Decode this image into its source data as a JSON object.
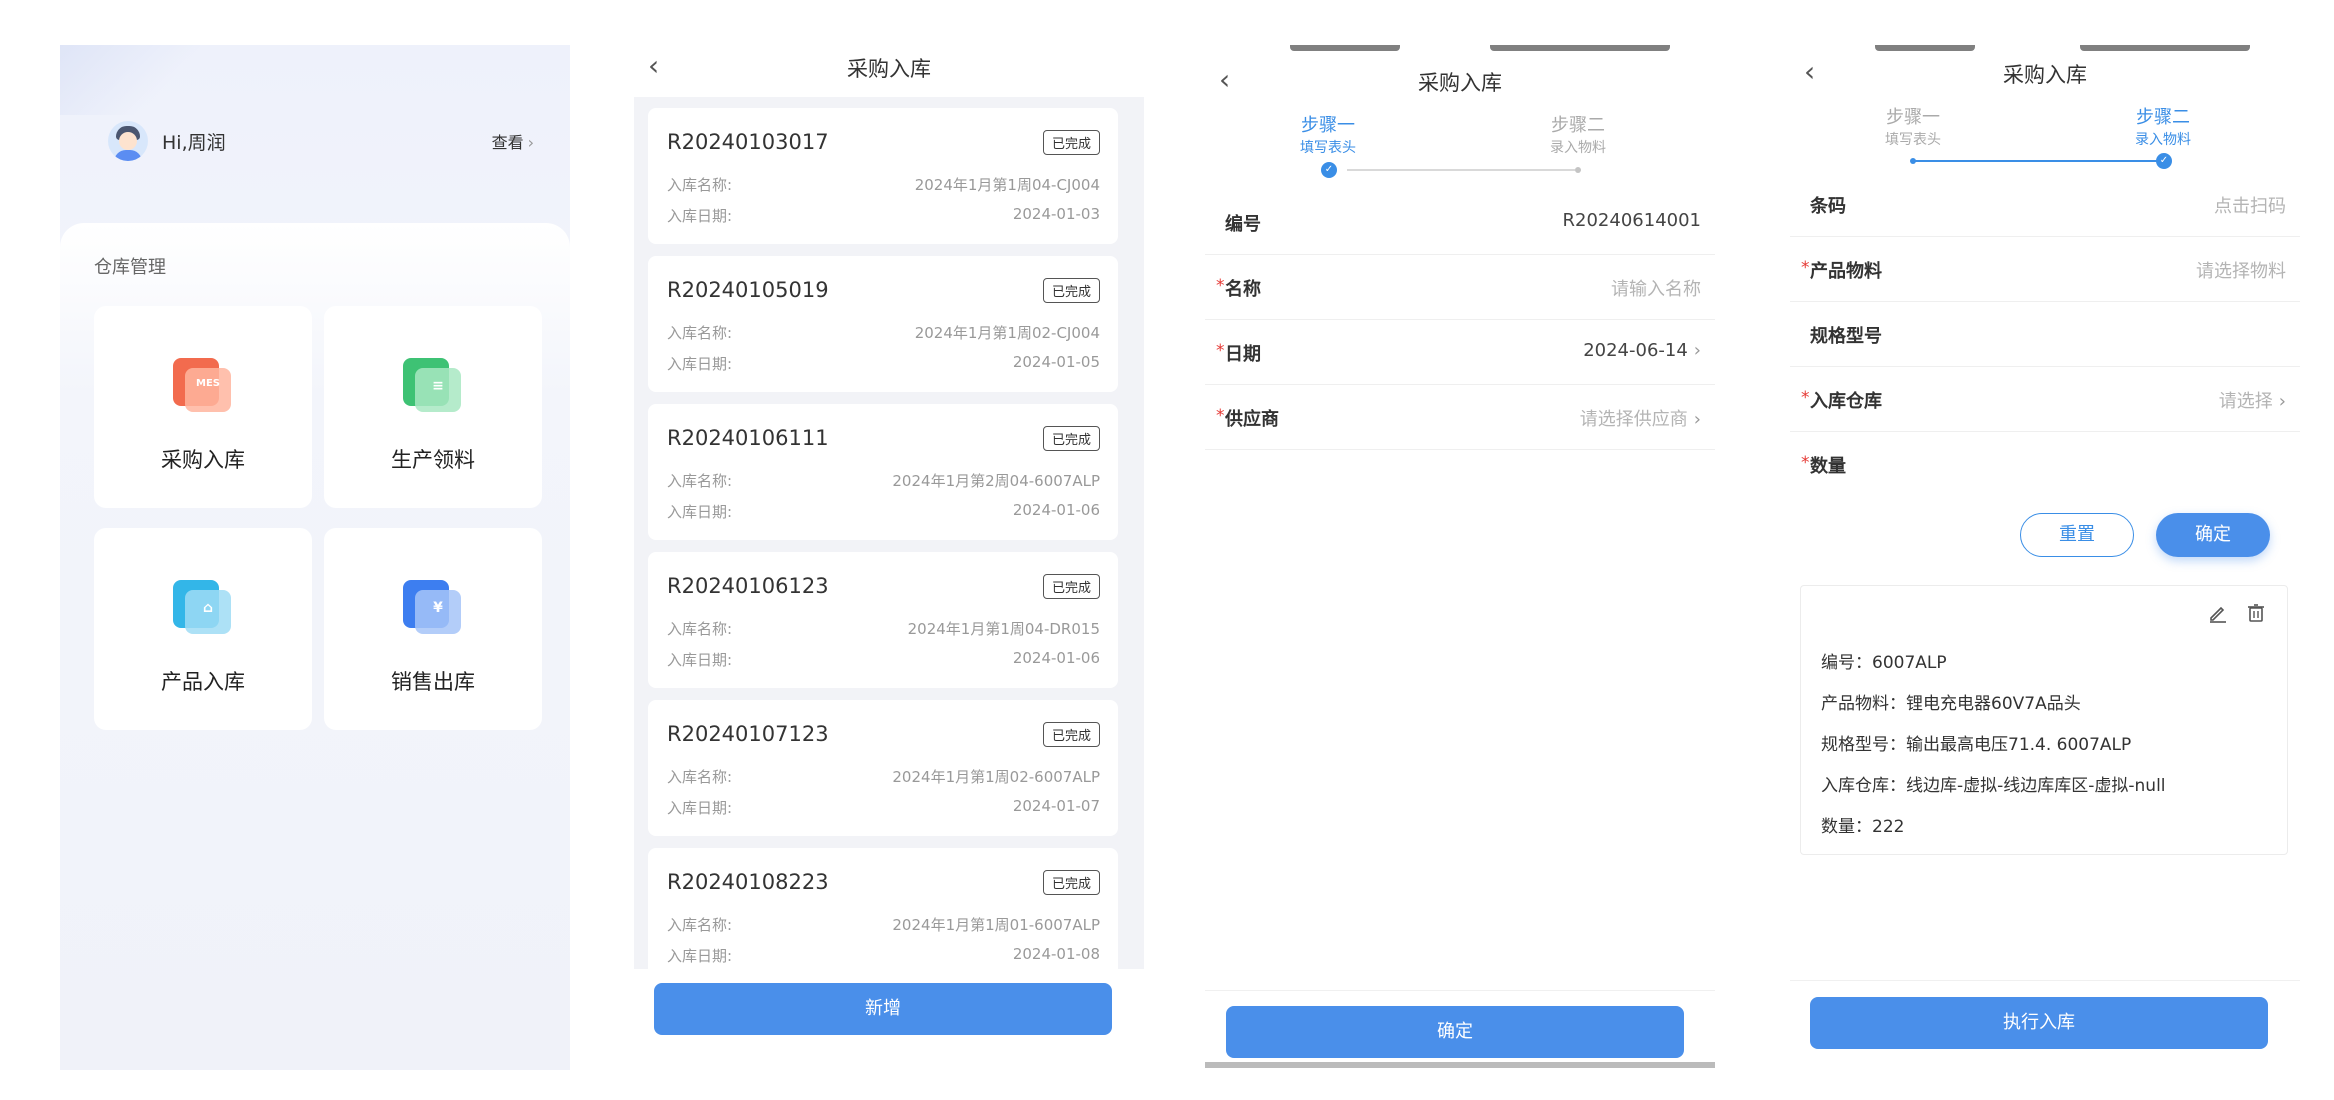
{
  "home": {
    "greeting": "Hi,周润",
    "view_link": "查看",
    "section_title": "仓库管理",
    "tiles": [
      {
        "label": "采购入库",
        "icon": "purchase-inbound-icon",
        "color": "#f26b4e",
        "glyph": "MES"
      },
      {
        "label": "生产领料",
        "icon": "production-picking-icon",
        "color": "#3ec274",
        "glyph": "≡"
      },
      {
        "label": "产品入库",
        "icon": "product-inbound-icon",
        "color": "#33b6e8",
        "glyph": "⌂"
      },
      {
        "label": "销售出库",
        "icon": "sales-outbound-icon",
        "color": "#3d7ef0",
        "glyph": "¥"
      }
    ]
  },
  "list_screen": {
    "title": "采购入库",
    "name_label": "入库名称:",
    "date_label": "入库日期:",
    "records": [
      {
        "no": "R20240103017",
        "status": "已完成",
        "name": "2024年1月第1周04-CJ004",
        "date": "2024-01-03"
      },
      {
        "no": "R20240105019",
        "status": "已完成",
        "name": "2024年1月第1周02-CJ004",
        "date": "2024-01-05"
      },
      {
        "no": "R20240106111",
        "status": "已完成",
        "name": "2024年1月第2周04-6007ALP",
        "date": "2024-01-06"
      },
      {
        "no": "R20240106123",
        "status": "已完成",
        "name": "2024年1月第1周04-DR015",
        "date": "2024-01-06"
      },
      {
        "no": "R20240107123",
        "status": "已完成",
        "name": "2024年1月第1周02-6007ALP",
        "date": "2024-01-07"
      },
      {
        "no": "R20240108223",
        "status": "已完成",
        "name": "2024年1月第1周01-6007ALP",
        "date": "2024-01-08"
      }
    ],
    "add_button": "新增"
  },
  "step1_screen": {
    "title": "采购入库",
    "steps": [
      {
        "title": "步骤一",
        "sub": "填写表头"
      },
      {
        "title": "步骤二",
        "sub": "录入物料"
      }
    ],
    "fields": [
      {
        "label": "编号",
        "value": "R20240614001",
        "required": false,
        "placeholder": false,
        "chevron": false
      },
      {
        "label": "名称",
        "value": "请输入名称",
        "required": true,
        "placeholder": true,
        "chevron": false
      },
      {
        "label": "日期",
        "value": "2024-06-14",
        "required": true,
        "placeholder": false,
        "chevron": true
      },
      {
        "label": "供应商",
        "value": "请选择供应商",
        "required": true,
        "placeholder": true,
        "chevron": true
      }
    ],
    "confirm_button": "确定"
  },
  "step2_screen": {
    "title": "采购入库",
    "steps": [
      {
        "title": "步骤一",
        "sub": "填写表头"
      },
      {
        "title": "步骤二",
        "sub": "录入物料"
      }
    ],
    "fields": [
      {
        "label": "条码",
        "value": "点击扫码",
        "required": false,
        "placeholder": true,
        "chevron": false
      },
      {
        "label": "产品物料",
        "value": "请选择物料",
        "required": true,
        "placeholder": true,
        "chevron": false
      },
      {
        "label": "规格型号",
        "value": "",
        "required": false,
        "placeholder": true,
        "chevron": false
      },
      {
        "label": "入库仓库",
        "value": "请选择",
        "required": true,
        "placeholder": true,
        "chevron": true
      },
      {
        "label": "数量",
        "value": "",
        "required": true,
        "placeholder": true,
        "chevron": false
      }
    ],
    "reset_button": "重置",
    "confirm_button": "确定",
    "item": {
      "code": "编号：6007ALP",
      "material": "产品物料：锂电充电器60V7A品头",
      "spec": "规格型号：输出最高电压71.4. 6007ALP",
      "warehouse": "入库仓库：线边库-虚拟-线边库库区-虚拟-null",
      "quantity": "数量：222"
    },
    "execute_button": "执行入库"
  },
  "colors": {
    "primary": "#4a8fea",
    "step_active": "#3a8ee6",
    "required": "#e53935",
    "placeholder": "#b4b4b4"
  }
}
